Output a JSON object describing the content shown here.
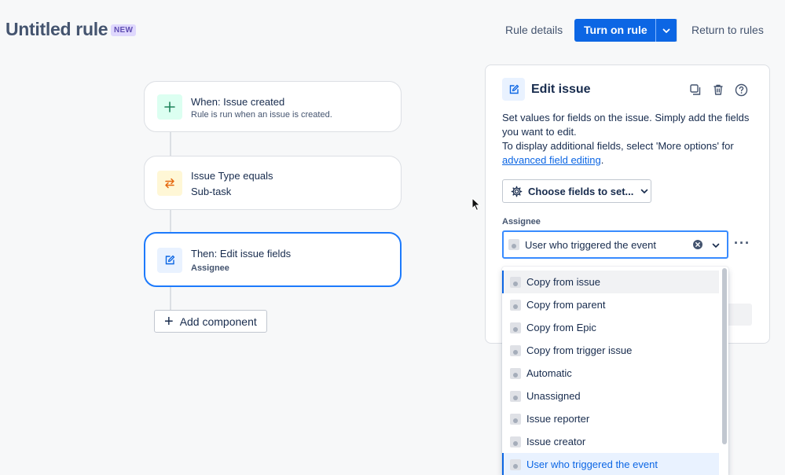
{
  "header": {
    "title": "Untitled rule",
    "badge": "NEW",
    "rule_details": "Rule details",
    "turn_on": "Turn on rule",
    "return_rules": "Return to rules"
  },
  "flow": {
    "trigger": {
      "title": "When: Issue created",
      "subtitle": "Rule is run when an issue is created."
    },
    "condition": {
      "title": "Issue Type equals",
      "subtitle": "Sub-task"
    },
    "action": {
      "title": "Then: Edit issue fields",
      "subtitle": "Assignee"
    },
    "add_component": "Add component"
  },
  "panel": {
    "title": "Edit issue",
    "desc_line1": "Set values for fields on the issue. Simply add the fields you want to edit.",
    "desc_line2": "To display additional fields, select 'More options' for ",
    "desc_link": "advanced field editing",
    "desc_end": ".",
    "choose_fields": "Choose fields to set...",
    "assignee_label": "Assignee",
    "assignee_value": "User who triggered the event"
  },
  "dropdown": {
    "options": [
      "Copy from issue",
      "Copy from parent",
      "Copy from Epic",
      "Copy from trigger issue",
      "Automatic",
      "Unassigned",
      "Issue reporter",
      "Issue creator",
      "User who triggered the event"
    ],
    "hovered_index": 0,
    "selected_index": 8
  },
  "colors": {
    "primary": "#0c66e4",
    "focus_border": "#388bff",
    "badge_bg": "#dfd8fd",
    "trigger_icon_bg": "#dcfff1",
    "condition_icon_bg": "#fff7d6",
    "action_icon_bg": "#e9f2ff"
  }
}
